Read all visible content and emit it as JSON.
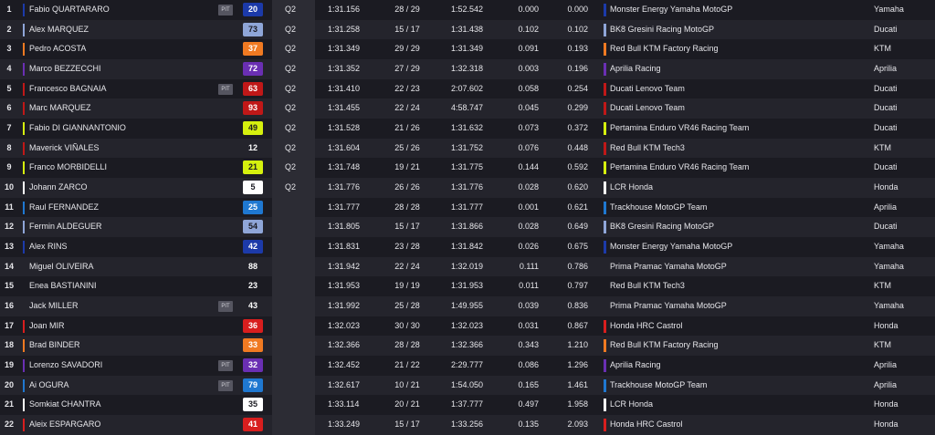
{
  "riders": [
    {
      "pos": "1",
      "name": "Fabio QUARTARARO",
      "pit": "PIT",
      "num": "20",
      "num_bg": "#1c3aa9",
      "num_fg": "#ffffff",
      "session": "Q2",
      "best": "1:31.156",
      "laps": "28 / 29",
      "last": "1:52.542",
      "gap": "0.000",
      "interval": "0.000",
      "team": "Monster Energy Yamaha MotoGP",
      "team_color": "#1c3aa9",
      "maker": "Yamaha"
    },
    {
      "pos": "2",
      "name": "Alex MARQUEZ",
      "pit": "",
      "num": "73",
      "num_bg": "#8fa6d8",
      "num_fg": "#1b1b22",
      "session": "Q2",
      "best": "1:31.258",
      "laps": "15 / 17",
      "last": "1:31.438",
      "gap": "0.102",
      "interval": "0.102",
      "team": "BK8 Gresini Racing MotoGP",
      "team_color": "#8fa6d8",
      "maker": "Ducati"
    },
    {
      "pos": "3",
      "name": "Pedro ACOSTA",
      "pit": "",
      "num": "37",
      "num_bg": "#f07a22",
      "num_fg": "#ffffff",
      "session": "Q2",
      "best": "1:31.349",
      "laps": "29 / 29",
      "last": "1:31.349",
      "gap": "0.091",
      "interval": "0.193",
      "team": "Red Bull KTM Factory Racing",
      "team_color": "#f07a22",
      "maker": "KTM"
    },
    {
      "pos": "4",
      "name": "Marco BEZZECCHI",
      "pit": "",
      "num": "72",
      "num_bg": "#6a2fb3",
      "num_fg": "#ffffff",
      "session": "Q2",
      "best": "1:31.352",
      "laps": "27 / 29",
      "last": "1:32.318",
      "gap": "0.003",
      "interval": "0.196",
      "team": "Aprilia Racing",
      "team_color": "#6a2fb3",
      "maker": "Aprilia"
    },
    {
      "pos": "5",
      "name": "Francesco BAGNAIA",
      "pit": "PIT",
      "num": "63",
      "num_bg": "#c01818",
      "num_fg": "#ffffff",
      "session": "Q2",
      "best": "1:31.410",
      "laps": "22 / 23",
      "last": "2:07.602",
      "gap": "0.058",
      "interval": "0.254",
      "team": "Ducati Lenovo Team",
      "team_color": "#c01818",
      "maker": "Ducati"
    },
    {
      "pos": "6",
      "name": "Marc MARQUEZ",
      "pit": "",
      "num": "93",
      "num_bg": "#c01818",
      "num_fg": "#ffffff",
      "session": "Q2",
      "best": "1:31.455",
      "laps": "22 / 24",
      "last": "4:58.747",
      "gap": "0.045",
      "interval": "0.299",
      "team": "Ducati Lenovo Team",
      "team_color": "#c01818",
      "maker": "Ducati"
    },
    {
      "pos": "7",
      "name": "Fabio DI GIANNANTONIO",
      "pit": "",
      "num": "49",
      "num_bg": "#d5f00e",
      "num_fg": "#1b1b22",
      "session": "Q2",
      "best": "1:31.528",
      "laps": "21 / 26",
      "last": "1:31.632",
      "gap": "0.073",
      "interval": "0.372",
      "team": "Pertamina Enduro VR46 Racing Team",
      "team_color": "#d5f00e",
      "maker": "Ducati"
    },
    {
      "pos": "8",
      "name": "Maverick VIÑALES",
      "pit": "",
      "num": "12",
      "num_bg": "",
      "num_fg": "#ffffff",
      "session": "Q2",
      "best": "1:31.604",
      "laps": "25 / 26",
      "last": "1:31.752",
      "gap": "0.076",
      "interval": "0.448",
      "team": "Red Bull KTM Tech3",
      "team_color": "#c01818",
      "maker": "KTM"
    },
    {
      "pos": "9",
      "name": "Franco MORBIDELLI",
      "pit": "",
      "num": "21",
      "num_bg": "#d5f00e",
      "num_fg": "#1b1b22",
      "session": "Q2",
      "best": "1:31.748",
      "laps": "19 / 21",
      "last": "1:31.775",
      "gap": "0.144",
      "interval": "0.592",
      "team": "Pertamina Enduro VR46 Racing Team",
      "team_color": "#d5f00e",
      "maker": "Ducati"
    },
    {
      "pos": "10",
      "name": "Johann ZARCO",
      "pit": "",
      "num": "5",
      "num_bg": "#ffffff",
      "num_fg": "#1b1b22",
      "session": "Q2",
      "best": "1:31.776",
      "laps": "26 / 26",
      "last": "1:31.776",
      "gap": "0.028",
      "interval": "0.620",
      "team": "LCR Honda",
      "team_color": "#ffffff",
      "maker": "Honda"
    },
    {
      "pos": "11",
      "name": "Raul FERNANDEZ",
      "pit": "",
      "num": "25",
      "num_bg": "#1f78d1",
      "num_fg": "#ffffff",
      "session": "",
      "best": "1:31.777",
      "laps": "28 / 28",
      "last": "1:31.777",
      "gap": "0.001",
      "interval": "0.621",
      "team": "Trackhouse MotoGP Team",
      "team_color": "#1f78d1",
      "maker": "Aprilia"
    },
    {
      "pos": "12",
      "name": "Fermin ALDEGUER",
      "pit": "",
      "num": "54",
      "num_bg": "#8fa6d8",
      "num_fg": "#1b1b22",
      "session": "",
      "best": "1:31.805",
      "laps": "15 / 17",
      "last": "1:31.866",
      "gap": "0.028",
      "interval": "0.649",
      "team": "BK8 Gresini Racing MotoGP",
      "team_color": "#8fa6d8",
      "maker": "Ducati"
    },
    {
      "pos": "13",
      "name": "Alex RINS",
      "pit": "",
      "num": "42",
      "num_bg": "#1c3aa9",
      "num_fg": "#ffffff",
      "session": "",
      "best": "1:31.831",
      "laps": "23 / 28",
      "last": "1:31.842",
      "gap": "0.026",
      "interval": "0.675",
      "team": "Monster Energy Yamaha MotoGP",
      "team_color": "#1c3aa9",
      "maker": "Yamaha"
    },
    {
      "pos": "14",
      "name": "Miguel OLIVEIRA",
      "pit": "",
      "num": "88",
      "num_bg": "",
      "num_fg": "#ffffff",
      "session": "",
      "best": "1:31.942",
      "laps": "22 / 24",
      "last": "1:32.019",
      "gap": "0.111",
      "interval": "0.786",
      "team": "Prima Pramac Yamaha MotoGP",
      "team_color": "",
      "maker": "Yamaha"
    },
    {
      "pos": "15",
      "name": "Enea BASTIANINI",
      "pit": "",
      "num": "23",
      "num_bg": "",
      "num_fg": "#ffffff",
      "session": "",
      "best": "1:31.953",
      "laps": "19 / 19",
      "last": "1:31.953",
      "gap": "0.011",
      "interval": "0.797",
      "team": "Red Bull KTM Tech3",
      "team_color": "",
      "maker": "KTM"
    },
    {
      "pos": "16",
      "name": "Jack MILLER",
      "pit": "PIT",
      "num": "43",
      "num_bg": "",
      "num_fg": "#ffffff",
      "session": "",
      "best": "1:31.992",
      "laps": "25 / 28",
      "last": "1:49.955",
      "gap": "0.039",
      "interval": "0.836",
      "team": "Prima Pramac Yamaha MotoGP",
      "team_color": "",
      "maker": "Yamaha"
    },
    {
      "pos": "17",
      "name": "Joan MIR",
      "pit": "",
      "num": "36",
      "num_bg": "#d81e1e",
      "num_fg": "#ffffff",
      "session": "",
      "best": "1:32.023",
      "laps": "30 / 30",
      "last": "1:32.023",
      "gap": "0.031",
      "interval": "0.867",
      "team": "Honda HRC Castrol",
      "team_color": "#d81e1e",
      "maker": "Honda"
    },
    {
      "pos": "18",
      "name": "Brad BINDER",
      "pit": "",
      "num": "33",
      "num_bg": "#f07a22",
      "num_fg": "#ffffff",
      "session": "",
      "best": "1:32.366",
      "laps": "28 / 28",
      "last": "1:32.366",
      "gap": "0.343",
      "interval": "1.210",
      "team": "Red Bull KTM Factory Racing",
      "team_color": "#f07a22",
      "maker": "KTM"
    },
    {
      "pos": "19",
      "name": "Lorenzo SAVADORI",
      "pit": "PIT",
      "num": "32",
      "num_bg": "#6a2fb3",
      "num_fg": "#ffffff",
      "session": "",
      "best": "1:32.452",
      "laps": "21 / 22",
      "last": "2:29.777",
      "gap": "0.086",
      "interval": "1.296",
      "team": "Aprilia Racing",
      "team_color": "#6a2fb3",
      "maker": "Aprilia"
    },
    {
      "pos": "20",
      "name": "Ai OGURA",
      "pit": "PIT",
      "num": "79",
      "num_bg": "#1f78d1",
      "num_fg": "#ffffff",
      "session": "",
      "best": "1:32.617",
      "laps": "10 / 21",
      "last": "1:54.050",
      "gap": "0.165",
      "interval": "1.461",
      "team": "Trackhouse MotoGP Team",
      "team_color": "#1f78d1",
      "maker": "Aprilia"
    },
    {
      "pos": "21",
      "name": "Somkiat CHANTRA",
      "pit": "",
      "num": "35",
      "num_bg": "#ffffff",
      "num_fg": "#1b1b22",
      "session": "",
      "best": "1:33.114",
      "laps": "20 / 21",
      "last": "1:37.777",
      "gap": "0.497",
      "interval": "1.958",
      "team": "LCR Honda",
      "team_color": "#ffffff",
      "maker": "Honda"
    },
    {
      "pos": "22",
      "name": "Aleix ESPARGARO",
      "pit": "",
      "num": "41",
      "num_bg": "#d81e1e",
      "num_fg": "#ffffff",
      "session": "",
      "best": "1:33.249",
      "laps": "15 / 17",
      "last": "1:33.256",
      "gap": "0.135",
      "interval": "2.093",
      "team": "Honda HRC Castrol",
      "team_color": "#d81e1e",
      "maker": "Honda"
    }
  ]
}
